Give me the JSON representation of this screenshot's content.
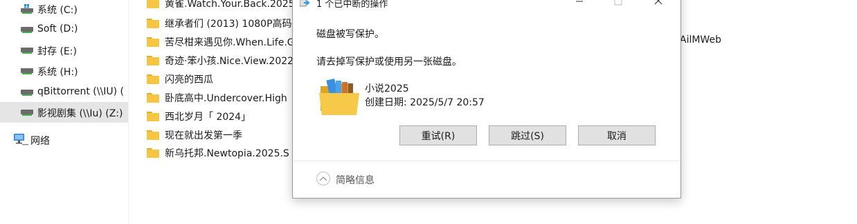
{
  "nav": {
    "items": [
      {
        "label": "系统 (C:)",
        "icon": "windows-drive-icon"
      },
      {
        "label": "Soft (D:)",
        "icon": "drive-icon"
      },
      {
        "label": "封存 (E:)",
        "icon": "drive-icon"
      },
      {
        "label": "系统 (H:)",
        "icon": "drive-icon"
      },
      {
        "label": "qBittorrent (\\\\IU) (",
        "icon": "network-drive-icon"
      },
      {
        "label": "影视剧集 (\\\\Iu) (Z:)",
        "icon": "network-drive-icon",
        "selected": true
      }
    ],
    "network": {
      "label": "网络",
      "icon": "network-icon"
    }
  },
  "files": [
    {
      "name": "黄雀.Watch.Your.Back.2025"
    },
    {
      "name": "继承者们 (2013) 1080P高码"
    },
    {
      "name": "苦尽柑来遇见你.When.Life.Gives"
    },
    {
      "name": "奇迹·笨小孩.Nice.View.2022"
    },
    {
      "name": "闪亮的西瓜"
    },
    {
      "name": "卧底高中.Undercover.High"
    },
    {
      "name": "西北岁月「 2024」"
    },
    {
      "name": "现在就出发第一季"
    },
    {
      "name": "新乌托邦.Newtopia.2025.S"
    }
  ],
  "partial_right_text": "AilMWeb",
  "dialog": {
    "title": "1 个已中断的操作",
    "message": "磁盘被写保护。",
    "instruction": "请去掉写保护或使用另一张磁盘。",
    "item": {
      "name": "小说2025",
      "date": "创建日期: 2025/5/7 20:57",
      "icon": "folder-with-files-icon"
    },
    "buttons": {
      "retry": "重试(R)",
      "skip": "跳过(S)",
      "cancel": "取消"
    },
    "details_label": "简略信息"
  }
}
